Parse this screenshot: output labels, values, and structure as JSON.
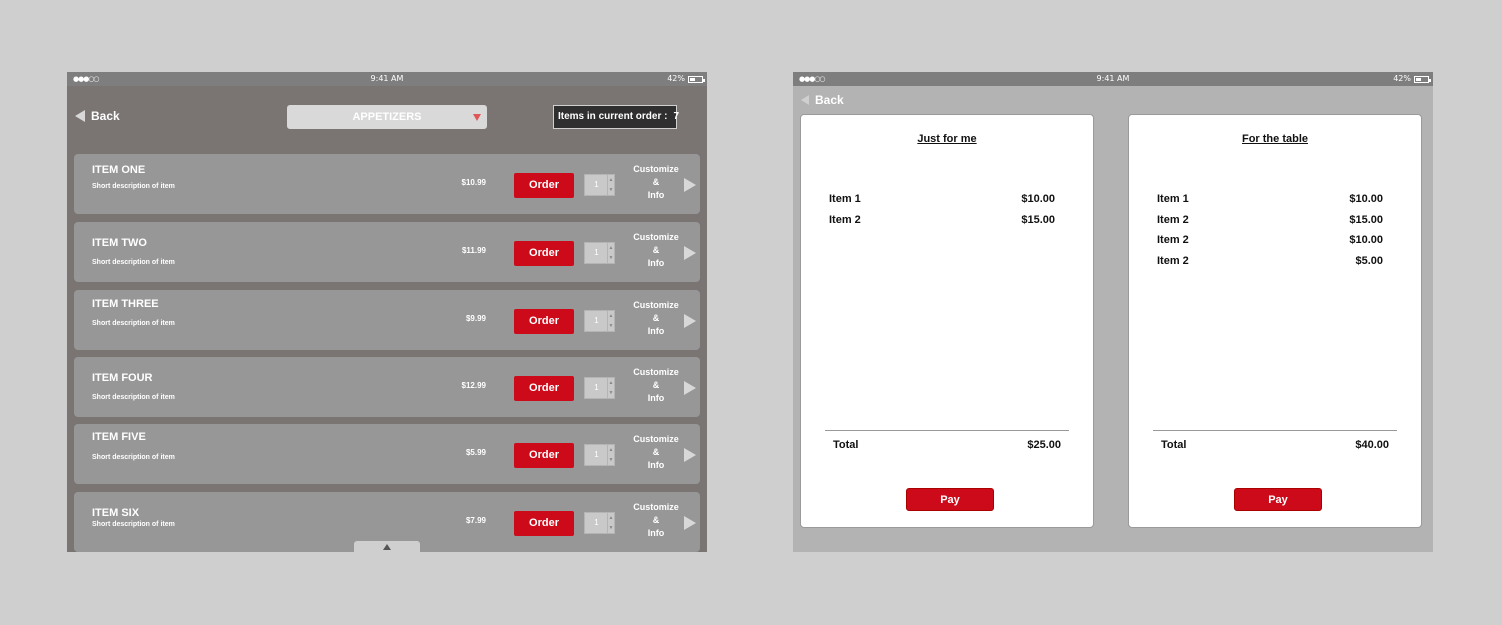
{
  "screen1": {
    "status": {
      "signal": "●●●○○",
      "time": "9:41 AM",
      "battery": "42%"
    },
    "back_label": "Back",
    "category_select": "APPETIZERS",
    "order_count_label": "Items in current order :",
    "order_count_value": "7",
    "customize_label": [
      "Customize",
      "&",
      "Info"
    ],
    "order_label": "Order",
    "items": [
      {
        "name": "ITEM ONE",
        "desc": "Short description of item",
        "price": "$10.99",
        "qty": "1"
      },
      {
        "name": "ITEM TWO",
        "desc": "Short description of item",
        "price": "$11.99",
        "qty": "1"
      },
      {
        "name": "ITEM THREE",
        "desc": "Short description of item",
        "price": "$9.99",
        "qty": "1"
      },
      {
        "name": "ITEM FOUR",
        "desc": "Short description of item",
        "price": "$12.99",
        "qty": "1"
      },
      {
        "name": "ITEM FIVE",
        "desc": "Short description of item",
        "price": "$5.99",
        "qty": "1"
      },
      {
        "name": "ITEM SIX",
        "desc": "Short description of item",
        "price": "$7.99",
        "qty": "1"
      }
    ]
  },
  "screen2": {
    "status": {
      "signal": "●●●○○",
      "time": "9:41 AM",
      "battery": "42%"
    },
    "back_label": "Back",
    "bills": [
      {
        "title": "Just for me",
        "lines": [
          {
            "label": "Item 1",
            "amount": "$10.00"
          },
          {
            "label": "Item 2",
            "amount": "$15.00"
          }
        ],
        "total_label": "Total",
        "total": "$25.00",
        "pay_label": "Pay"
      },
      {
        "title": "For the table",
        "lines": [
          {
            "label": "Item 1",
            "amount": "$10.00"
          },
          {
            "label": "Item 2",
            "amount": "$15.00"
          },
          {
            "label": "Item 2",
            "amount": "$10.00"
          },
          {
            "label": "Item 2",
            "amount": "$5.00"
          }
        ],
        "total_label": "Total",
        "total": "$40.00",
        "pay_label": "Pay"
      }
    ]
  }
}
